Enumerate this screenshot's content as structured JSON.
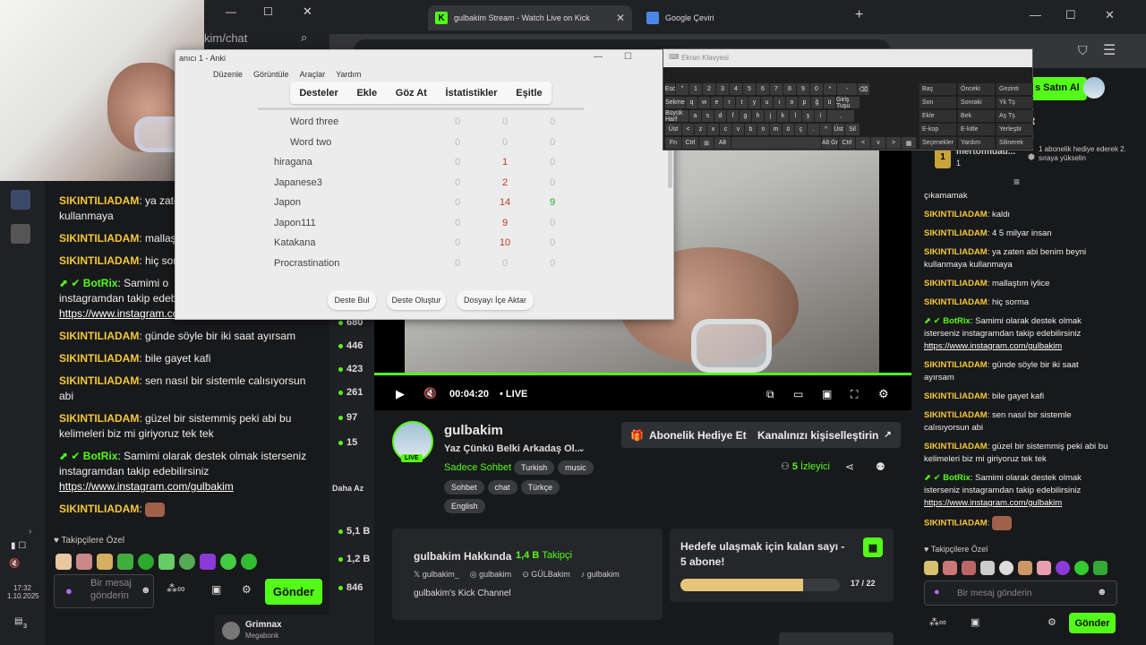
{
  "browser": {
    "tabs": [
      {
        "title": "gulbakim Stream - Watch Live on Kick",
        "icon": "kick-icon"
      },
      {
        "title": "Google Çeviri",
        "icon": "translate-icon"
      }
    ],
    "popup_url": "kim/chat"
  },
  "taskbar": {
    "time": "17:32",
    "date": "1.10.2025",
    "badge": "3"
  },
  "left_chat": {
    "messages": [
      {
        "user": "SIKINTILIADAM",
        "text": "ya zate",
        "cont": "kullanmaya"
      },
      {
        "user": "SIKINTILIADAM",
        "text": "mallaşt"
      },
      {
        "user": "SIKINTILIADAM",
        "text": "hiç sorı"
      },
      {
        "user": "BotRix",
        "text": "Samimi o",
        "cont": "instagramdan takip edebi",
        "link": "https://www.instagram.com/gulbakim"
      },
      {
        "user": "SIKINTILIADAM",
        "text": "günde söyle bir iki saat ayırsam"
      },
      {
        "user": "SIKINTILIADAM",
        "text": "bile gayet kafi"
      },
      {
        "user": "SIKINTILIADAM",
        "text": "sen nasıl bir sistemle calısıyorsun",
        "cont": "abi"
      },
      {
        "user": "SIKINTILIADAM",
        "text": "güzel bir sistemmiş peki abi bu",
        "cont": "kelimeleri biz mi giriyoruz tek tek"
      },
      {
        "user": "BotRix",
        "text": "Samimi olarak destek olmak isterseniz",
        "cont": "instagramdan takip edebilirsiniz",
        "link": "https://www.instagram.com/gulbakim"
      },
      {
        "user": "SIKINTILIADAM",
        "text": ""
      }
    ],
    "followers_label": "Takipçilere Özel",
    "input_placeholder": "Bir mesaj gönderin",
    "send_label": "Gönder"
  },
  "sidebar_counts": [
    "680",
    "446",
    "423",
    "261",
    "97",
    "15",
    "Daha Az",
    "5,1 B",
    "1,2 B",
    "846"
  ],
  "sidebar_user": {
    "name": "Grimnax",
    "game": "Megabonk"
  },
  "anki": {
    "title": "anıcı 1 - Anki",
    "menu": [
      "Düzenle",
      "Görüntüle",
      "Araçlar",
      "Yardım"
    ],
    "toolbar": [
      "Desteler",
      "Ekle",
      "Göz At",
      "İstatistikler",
      "Eşitle"
    ],
    "decks": [
      {
        "name": "Word three",
        "a": "0",
        "b": "0",
        "c": "0",
        "indent": true
      },
      {
        "name": "Word two",
        "a": "0",
        "b": "0",
        "c": "0",
        "indent": true
      },
      {
        "name": "hiragana",
        "a": "0",
        "b": "1",
        "c": "0"
      },
      {
        "name": "Japanese3",
        "a": "0",
        "b": "2",
        "c": "0"
      },
      {
        "name": "Japon",
        "a": "0",
        "b": "14",
        "c": "9"
      },
      {
        "name": "Japon111",
        "a": "0",
        "b": "9",
        "c": "0"
      },
      {
        "name": "Katakana",
        "a": "0",
        "b": "10",
        "c": "0"
      },
      {
        "name": "Procrastination",
        "a": "0",
        "b": "0",
        "c": "0"
      }
    ],
    "buttons": [
      "Deste Bul",
      "Deste Oluştur",
      "Dosyayı İçe Aktar"
    ]
  },
  "keyboard": {
    "title": "Ekran Klavyesi",
    "rows": [
      [
        "Esc",
        "\"",
        "1",
        "2",
        "3",
        "4",
        "5",
        "6",
        "7",
        "8",
        "9",
        "0",
        "*",
        "-",
        "⌫"
      ],
      [
        "Sekme",
        "q",
        "w",
        "e",
        "r",
        "t",
        "y",
        "u",
        "ı",
        "o",
        "p",
        "ğ",
        "ü",
        "Giriş Tuşu"
      ],
      [
        "Büyük Harf",
        "a",
        "s",
        "d",
        "f",
        "g",
        "h",
        "j",
        "k",
        "l",
        "ş",
        "i",
        ","
      ],
      [
        "Üst",
        "<",
        "z",
        "x",
        "c",
        "v",
        "b",
        "n",
        "m",
        "ö",
        "ç",
        ".",
        "^",
        "Üst",
        "Sil"
      ],
      [
        "Fn",
        "Ctrl",
        "⊞",
        "Alt",
        "",
        "Alt Gr",
        "Ctrl",
        "<",
        "v",
        ">",
        "▦"
      ]
    ],
    "funcs": [
      [
        "Baş",
        "Önceki",
        "Gezinti"
      ],
      [
        "Son",
        "Sonraki",
        "Yk Tş"
      ],
      [
        "Ekle",
        "Bek",
        "Aş Tş"
      ],
      [
        "E-kop",
        "E-kitle",
        "Yerleştir"
      ],
      [
        "Seçenekler",
        "Yardım",
        "Silinerek"
      ]
    ]
  },
  "player": {
    "time": "00:04:20",
    "live": "LIVE",
    "progress": 1.0
  },
  "channel": {
    "name": "gulbakim",
    "title": "Yaz Çünkü Belki Arkadaş Ol...",
    "category": "Sadece Sohbet",
    "tags": [
      "Turkish",
      "music",
      "Sohbet",
      "chat",
      "Türkçe",
      "English"
    ],
    "live_badge": "LIVE",
    "gift_label": "Abonelik Hediye Et",
    "customize_label": "Kanalınızı kişiselleştirin",
    "viewers_count": "5",
    "viewers_label": "İzleyici",
    "about_title": "gulbakim Hakkında",
    "followers": "1,4 B",
    "followers_label": "Takipçi",
    "socials": [
      "gulbakim_",
      "gulbakim",
      "GÜLBakim",
      "gulbakim"
    ],
    "about_text": "gulbakim's Kick Channel",
    "goal_text": "Hedefe ulaşmak için kalan sayı - 5 abone!",
    "goal_progress": "17 / 22",
    "goal_fraction": 0.77
  },
  "right_chat": {
    "subscribe_label": "s Satın Al",
    "chat_header": "t",
    "gifter_name": "mertofmuad...",
    "gifter_count": "1",
    "gift_note": "1 abonelik hediye ederek 2. sıraya yükselin",
    "messages": [
      {
        "user": "",
        "text": "çıkamamak"
      },
      {
        "user": "SIKINTILIADAM",
        "text": "kaldı"
      },
      {
        "user": "SIKINTILIADAM",
        "text": "4 5 milyar insan"
      },
      {
        "user": "SIKINTILIADAM",
        "text": "ya zaten abi benim beyni",
        "cont": "kullanmaya kullanmaya"
      },
      {
        "user": "SIKINTILIADAM",
        "text": "mallaştım iylice"
      },
      {
        "user": "SIKINTILIADAM",
        "text": "hiç sorma"
      },
      {
        "user": "BotRix",
        "text": "Samimi olarak destek olmak",
        "cont": "isterseniz instagramdan takip edebilirsiniz",
        "link": "https://www.instagram.com/gulbakim"
      },
      {
        "user": "SIKINTILIADAM",
        "text": "günde söyle bir iki saat",
        "cont": "ayırsam"
      },
      {
        "user": "SIKINTILIADAM",
        "text": "bile gayet kafi"
      },
      {
        "user": "SIKINTILIADAM",
        "text": "sen nasıl bir sistemle",
        "cont": "calısıyorsun abi"
      },
      {
        "user": "SIKINTILIADAM",
        "text": "güzel bir sistemmiş peki abi bu",
        "cont": "kelimeleri biz mi giriyoruz tek tek"
      },
      {
        "user": "BotRix",
        "text": "Samimi olarak destek olmak",
        "cont": "isterseniz instagramdan takip edebilirsiniz",
        "link": "https://www.instagram.com/gulbakim"
      },
      {
        "user": "SIKINTILIADAM",
        "text": ""
      }
    ],
    "followers_label": "Takipçilere Özel",
    "input_placeholder": "Bir mesaj gönderin",
    "send_label": "Gönder"
  },
  "colors": {
    "accent": "#53fc18",
    "username": "#f5c83a",
    "bg": "#18191b"
  }
}
